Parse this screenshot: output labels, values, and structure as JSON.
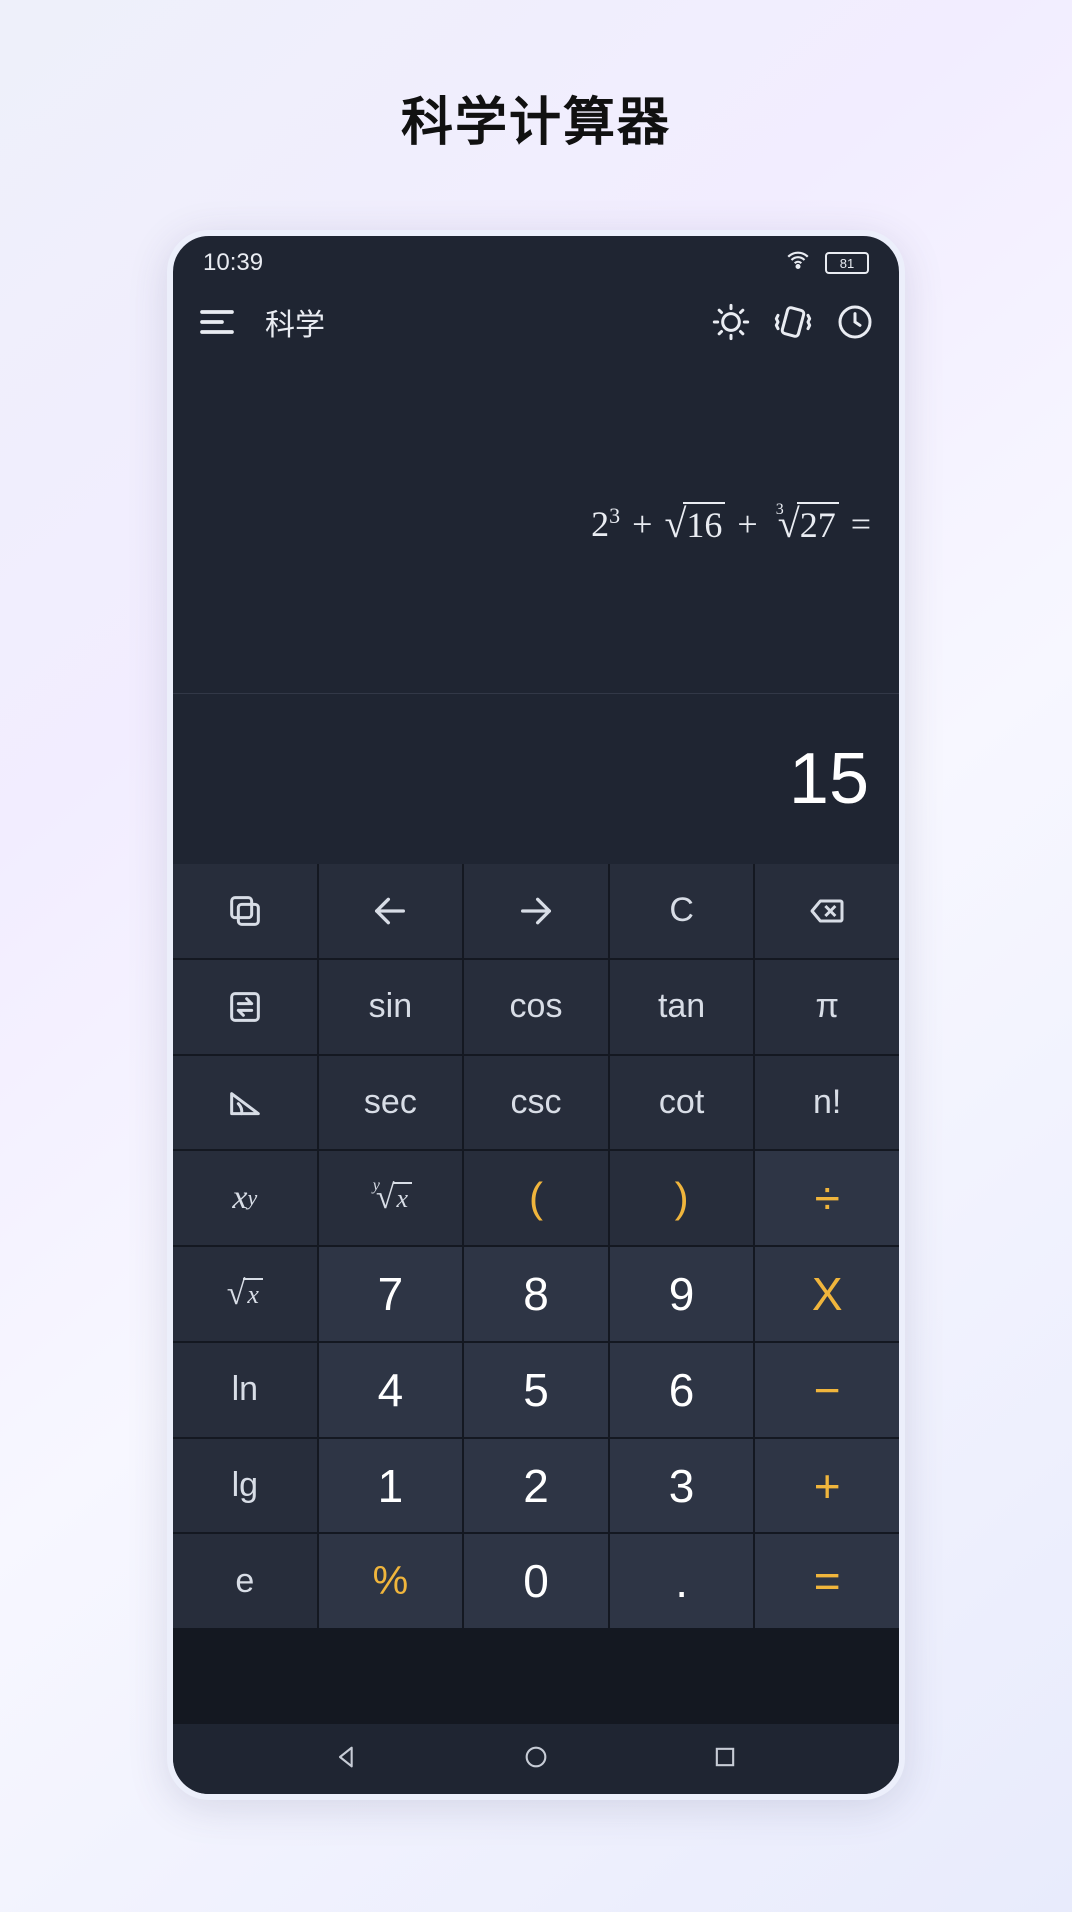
{
  "page_title": "科学计算器",
  "statusbar": {
    "time": "10:39",
    "battery": "81"
  },
  "header": {
    "mode_label": "科学"
  },
  "display": {
    "expression_plain": "2^3 + √16 + ∛27 =",
    "expr": {
      "base1": "2",
      "exp1": "3",
      "plus": "+",
      "rad2_arg": "16",
      "rad3_idx": "3",
      "rad3_arg": "27",
      "eq": "="
    },
    "result": "15"
  },
  "keys": {
    "r1": {
      "left": "⇦",
      "right": "⇨",
      "clear": "C"
    },
    "r2": {
      "sin": "sin",
      "cos": "cos",
      "tan": "tan",
      "pi": "π"
    },
    "r3": {
      "sec": "sec",
      "csc": "csc",
      "cot": "cot",
      "fact": "n!"
    },
    "r4": {
      "lparen": "(",
      "rparen": ")",
      "div": "÷"
    },
    "r5": {
      "n7": "7",
      "n8": "8",
      "n9": "9",
      "mul": "X"
    },
    "r6": {
      "ln": "ln",
      "n4": "4",
      "n5": "5",
      "n6": "6",
      "sub": "−"
    },
    "r7": {
      "lg": "lg",
      "n1": "1",
      "n2": "2",
      "n3": "3",
      "add": "+"
    },
    "r8": {
      "e": "e",
      "pct": "%",
      "n0": "0",
      "dot": ".",
      "eq": "="
    },
    "labels": {
      "xy_base": "x",
      "xy_exp": "y",
      "yroot_idx": "y",
      "yroot_arg": "x",
      "sqrt_arg": "x"
    }
  }
}
